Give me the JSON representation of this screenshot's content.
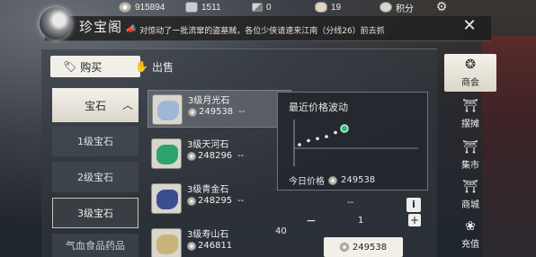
{
  "resources": {
    "silver_1": "915894",
    "silver_2": "1511",
    "item_3": "0",
    "pouch": "19",
    "points_label": "积分"
  },
  "header": {
    "title": "珍宝阁",
    "marquee": "对惊动了一批流窜的盗墓贼，各位少侠请速来江南（分线26）前去抓"
  },
  "tabs": {
    "buy": "购买",
    "sell": "出售"
  },
  "categories": {
    "main": "宝石",
    "items": [
      "1级宝石",
      "2级宝石",
      "3级宝石",
      "气血食品药品"
    ]
  },
  "items": [
    {
      "name": "3级月光石",
      "price": "249538",
      "dash": "--",
      "qty": "",
      "gem_color": "#9fb6d6"
    },
    {
      "name": "3级天河石",
      "price": "248296",
      "dash": "--",
      "qty": "",
      "gem_color": "#2fa36c"
    },
    {
      "name": "3级青金石",
      "price": "248295",
      "dash": "--",
      "qty": "",
      "gem_color": "#3b4f8f"
    },
    {
      "name": "3级寿山石",
      "price": "246811",
      "dash": "--",
      "qty": "40",
      "gem_color": "#c9b37a"
    }
  ],
  "popup": {
    "title": "最近价格波动",
    "today_label": "今日价格",
    "today_price": "249538"
  },
  "chart_data": {
    "type": "line",
    "x": [
      1,
      2,
      3,
      4,
      5,
      6
    ],
    "values": [
      0,
      1,
      1.5,
      2,
      3,
      4
    ],
    "highlight_index": 5,
    "grid": false
  },
  "detail": {
    "dash": "--",
    "count": "1",
    "total": "249538",
    "info": "i",
    "minus": "−",
    "plus": "+"
  },
  "nav": [
    "商会",
    "摆摊",
    "集市",
    "商城",
    "充值"
  ],
  "colors": {
    "accent_green": "#2fbf7a",
    "panel_light": "#f1efe8"
  }
}
